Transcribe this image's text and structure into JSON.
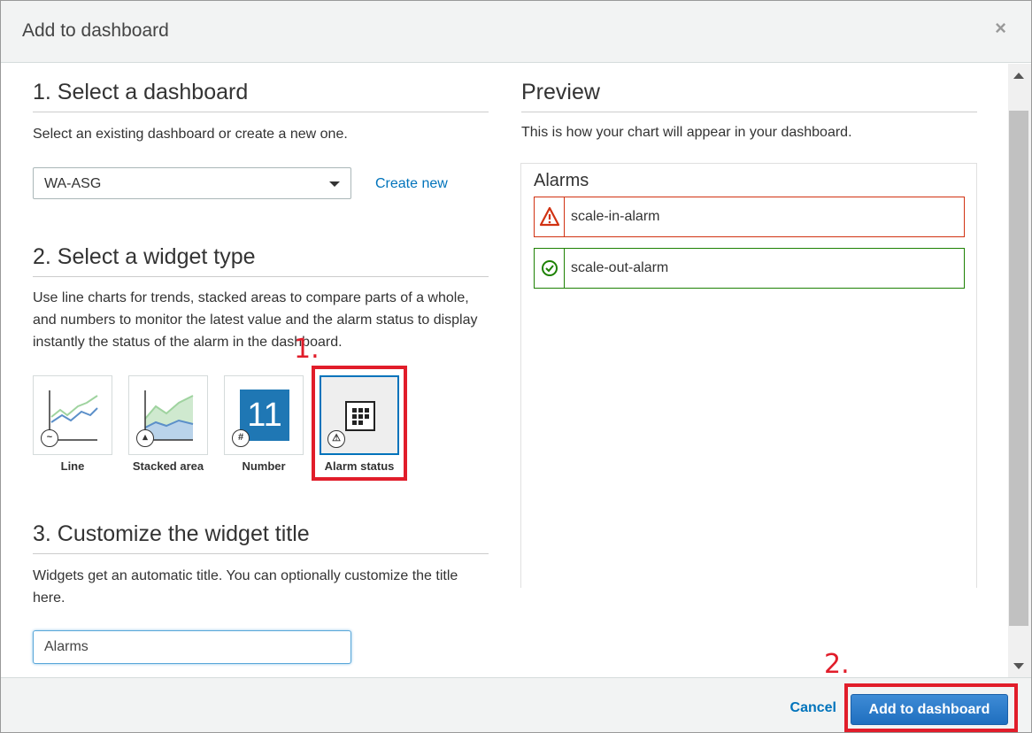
{
  "dialog": {
    "title": "Add to dashboard",
    "close_label": "×"
  },
  "step1": {
    "title": "1. Select a dashboard",
    "description": "Select an existing dashboard or create a new one.",
    "selected_dashboard": "WA-ASG",
    "create_new_label": "Create new"
  },
  "step2": {
    "title": "2. Select a widget type",
    "description": "Use line charts for trends, stacked areas to compare parts of a whole, and numbers to monitor the latest value and the alarm status to display instantly the status of the alarm in the dashboard.",
    "widgets": [
      {
        "label": "Line",
        "icon": "line-chart-icon"
      },
      {
        "label": "Stacked area",
        "icon": "stacked-area-icon"
      },
      {
        "label": "Number",
        "icon": "number-icon",
        "tile_value": "11"
      },
      {
        "label": "Alarm status",
        "icon": "alarm-status-icon",
        "selected": true
      }
    ]
  },
  "step3": {
    "title": "3. Customize the widget title",
    "description": "Widgets get an automatic title. You can optionally customize the title here.",
    "title_value": "Alarms"
  },
  "preview": {
    "title": "Preview",
    "description": "This is how your chart will appear in your dashboard.",
    "widget_title": "Alarms",
    "alarms": [
      {
        "name": "scale-in-alarm",
        "state": "alarm",
        "color": "#d13212",
        "icon": "warning-icon"
      },
      {
        "name": "scale-out-alarm",
        "state": "ok",
        "color": "#1d8102",
        "icon": "check-circle-icon"
      }
    ]
  },
  "footer": {
    "cancel_label": "Cancel",
    "submit_label": "Add to dashboard"
  },
  "annotations": {
    "marker1": "1.",
    "marker2": "2.",
    "color": "#e11d2a"
  }
}
